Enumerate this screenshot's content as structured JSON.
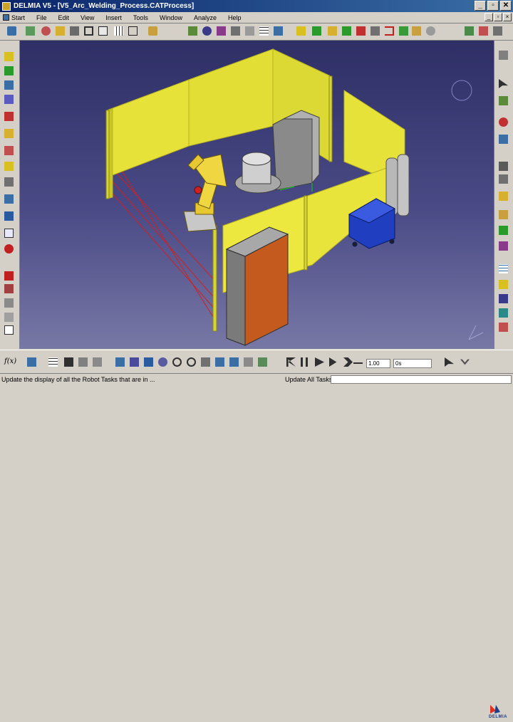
{
  "window": {
    "title": "DELMIA V5 - [V5_Arc_Welding_Process.CATProcess]",
    "minimize_glyph": "_",
    "maximize_glyph": "▫",
    "close_glyph": "✕"
  },
  "menu": {
    "items": [
      "Start",
      "File",
      "Edit",
      "View",
      "Insert",
      "Tools",
      "Window",
      "Analyze",
      "Help"
    ],
    "mdi_minimize": "_",
    "mdi_restore": "▫",
    "mdi_close": "×"
  },
  "simulation": {
    "speed_value": "1.00",
    "time_value": "0s",
    "foo_label": "f(x)"
  },
  "status": {
    "message": "Update the display of all the Robot Tasks that are in ...",
    "command": "Update All Tasks"
  },
  "branding": {
    "logo_text": "DELMIA"
  },
  "colors": {
    "fence_yellow": "#e6e23a",
    "robot_yellow": "#f0d640",
    "controller_orange": "#c45a1e",
    "cart_blue": "#1f3fc0",
    "viewport_bg": "#3c3c7a"
  }
}
